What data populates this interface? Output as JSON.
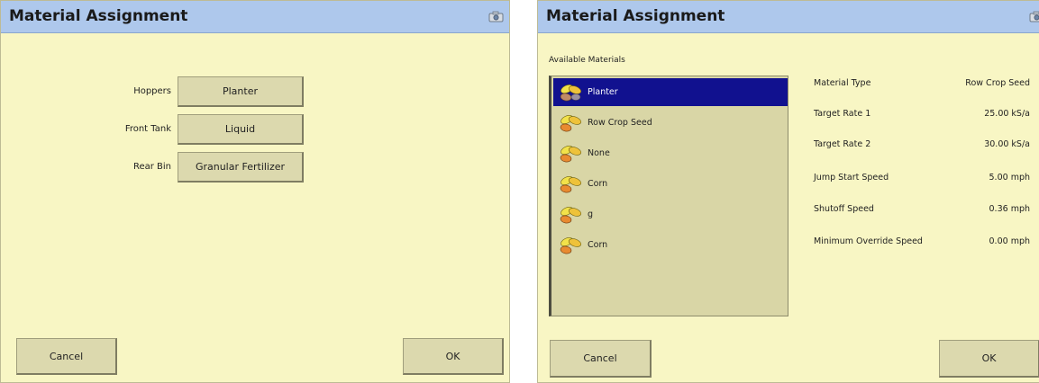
{
  "left": {
    "title": "Material Assignment",
    "rows": [
      {
        "label": "Hoppers",
        "value": "Planter"
      },
      {
        "label": "Front Tank",
        "value": "Liquid"
      },
      {
        "label": "Rear Bin",
        "value": "Granular Fertilizer"
      }
    ],
    "cancel_label": "Cancel",
    "ok_label": "OK"
  },
  "right": {
    "title": "Material Assignment",
    "available_label": "Available Materials",
    "materials": [
      "Planter",
      "Row Crop Seed",
      "None",
      "Corn",
      "g",
      "Corn"
    ],
    "selected_index": 0,
    "properties": [
      {
        "name": "Material Type",
        "value": "Row Crop Seed"
      },
      {
        "name": "Target Rate 1",
        "value": "25.00 kS/a"
      },
      {
        "name": "Target Rate 2",
        "value": "30.00 kS/a"
      },
      {
        "name": "Jump Start Speed",
        "value": "5.00 mph"
      },
      {
        "name": "Shutoff Speed",
        "value": "0.36 mph"
      },
      {
        "name": "Minimum Override Speed",
        "value": "0.00 mph"
      }
    ],
    "cancel_label": "Cancel",
    "ok_label": "OK"
  },
  "colors": {
    "panel_bg": "#f8f6c4",
    "titlebar": "#aec8ec",
    "button": "#dcd9ae",
    "list_bg": "#d9d6a6",
    "selected": "#11118f"
  },
  "icons": [
    "camera-icon",
    "seed-icon"
  ]
}
